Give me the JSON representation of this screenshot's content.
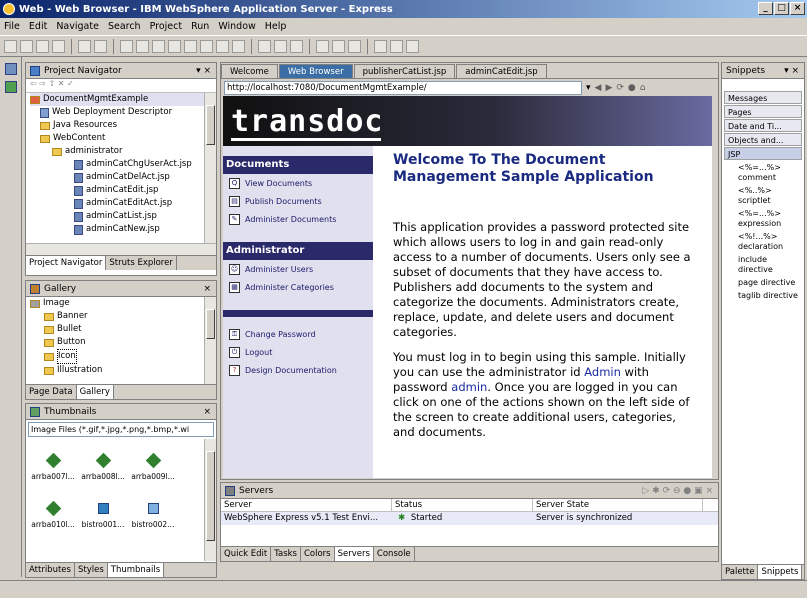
{
  "window": {
    "title": "Web - Web Browser - IBM WebSphere Application Server - Express",
    "minimize": "_",
    "maximize": "□",
    "close": "×"
  },
  "menu": [
    "File",
    "Edit",
    "Navigate",
    "Search",
    "Project",
    "Run",
    "Window",
    "Help"
  ],
  "project_navigator": {
    "title": "Project Navigator",
    "items": [
      {
        "label": "DocumentMgmtExample",
        "depth": 0,
        "kind": "project"
      },
      {
        "label": "Web Deployment Descriptor",
        "depth": 1,
        "kind": "descriptor"
      },
      {
        "label": "Java Resources",
        "depth": 1,
        "kind": "folder"
      },
      {
        "label": "WebContent",
        "depth": 1,
        "kind": "folder"
      },
      {
        "label": "administrator",
        "depth": 2,
        "kind": "folder"
      },
      {
        "label": "adminCatChgUserAct.jsp",
        "depth": 3,
        "kind": "jsp"
      },
      {
        "label": "adminCatDelAct.jsp",
        "depth": 3,
        "kind": "jsp"
      },
      {
        "label": "adminCatEdit.jsp",
        "depth": 3,
        "kind": "jsp"
      },
      {
        "label": "adminCatEditAct.jsp",
        "depth": 3,
        "kind": "jsp"
      },
      {
        "label": "adminCatList.jsp",
        "depth": 3,
        "kind": "jsp"
      },
      {
        "label": "adminCatNew.jsp",
        "depth": 3,
        "kind": "jsp"
      }
    ],
    "tabs": [
      "Project Navigator",
      "Struts Explorer"
    ]
  },
  "gallery": {
    "title": "Gallery",
    "items": [
      "Image",
      "Banner",
      "Bullet",
      "Button",
      "Icon",
      "Illustration"
    ],
    "tabs": [
      "Page Data",
      "Gallery"
    ]
  },
  "thumbnails": {
    "title": "Thumbnails",
    "filter": "Image Files (*.gif,*.jpg,*.png,*.bmp,*.wi",
    "row1": [
      "arrba007l...",
      "arrba008l...",
      "arrba009l..."
    ],
    "row2": [
      "arrba010l...",
      "bistro001...",
      "bistro002..."
    ],
    "tabs": [
      "Attributes",
      "Styles",
      "Thumbnails"
    ]
  },
  "editor_tabs": [
    "Welcome",
    "Web Browser",
    "publisherCatList.jsp",
    "adminCatEdit.jsp"
  ],
  "browser": {
    "url": "http://localhost:7080/DocumentMgmtExample/",
    "logo": "transdoc",
    "nav": {
      "documents_head": "Documents",
      "documents": [
        "View Documents",
        "Publish Documents",
        "Administer Documents"
      ],
      "admin_head": "Administrator",
      "admin": [
        "Administer Users",
        "Administer Categories"
      ],
      "user": [
        "Change Password",
        "Logout",
        "Design Documentation"
      ]
    },
    "welcome": "Welcome To The Document Management Sample Application",
    "para1": "This application provides a password protected site which allows users to log in and gain read-only access to a number of documents. Users only see a subset of documents that they have access to. Publishers add documents to the system and categorize the documents. Administrators create, replace, update, and delete users and document categories.",
    "para2_a": "You must log in to begin using this sample. Initially you can use the administrator id",
    "admin_id": "Admin",
    "para2_b": "with password",
    "admin_pw": "admin",
    "para2_c": ". Once you are logged in you can click on one of the actions shown on the left side of the screen to create additional users, categories, and documents."
  },
  "servers": {
    "title": "Servers",
    "columns": [
      "Server",
      "Status",
      "Server State"
    ],
    "row": {
      "server": "WebSphere Express v5.1 Test Envi...",
      "status": "Started",
      "state": "Server is synchronized"
    },
    "tabs": [
      "Quick Edit",
      "Tasks",
      "Colors",
      "Servers",
      "Console"
    ]
  },
  "snippets": {
    "title": "Snippets",
    "drawers": [
      "Messages",
      "Pages",
      "Date and Ti...",
      "Objects and...",
      "JSP"
    ],
    "items": [
      "<%=...%> comment",
      "<%..%> scriptlet",
      "<%=...%> expression",
      "<%!...%> declaration",
      "include directive",
      "page directive",
      "taglib directive"
    ],
    "tabs": [
      "Palette",
      "Snippets"
    ]
  }
}
